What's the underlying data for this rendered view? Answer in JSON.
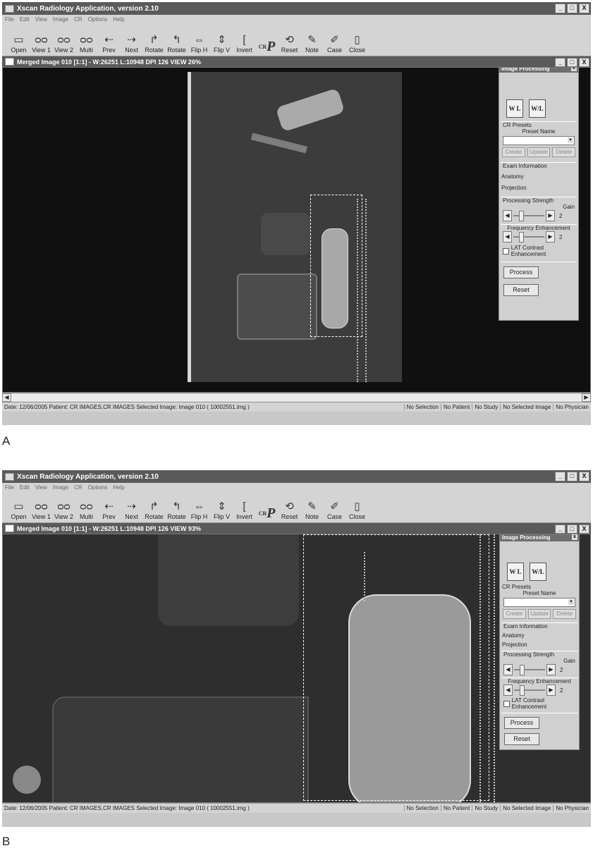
{
  "app": {
    "title": "Xscan Radiology Application, version 2.10",
    "window_controls": [
      "_",
      "□",
      "X"
    ]
  },
  "menu": [
    "File",
    "Edit",
    "View",
    "Image",
    "CR",
    "Options",
    "Help"
  ],
  "toolbar": {
    "open": "Open",
    "view1": "View 1",
    "view2": "View 2",
    "multi": "Multi",
    "prev": "Prev",
    "next": "Next",
    "rotate_cw": "Rotate",
    "rotate_ccw": "Rotate",
    "fliph": "Flip H",
    "flipv": "Flip V",
    "invert": "Invert",
    "cr_mark": "CR",
    "cr_letter": "P",
    "reset": "Reset",
    "note": "Note",
    "case": "Case",
    "close": "Close"
  },
  "panel": {
    "title": "Image Processing",
    "close": "x",
    "wl1": "W L",
    "wl2": "W/L",
    "cr_presets": "CR Presets",
    "preset_name": "Preset Name",
    "create": "Create",
    "update": "Update",
    "delete": "Delete",
    "exam_info": "Exam Information",
    "anatomy": "Anatomy",
    "projection": "Projection",
    "proc_strength": "Processing Strength",
    "gain": "Gain",
    "gain_value": "2",
    "freq_enh": "Frequency Enhancement",
    "freq_value": "2",
    "lat_contrast": "LAT Contrast Enhancement",
    "process": "Process",
    "reset": "Reset"
  },
  "status": {
    "left": "Date: 12/06/2005    Patient: CR IMAGES,CR IMAGES    Selected Image: Image 010  ( 10002551.img )",
    "cells": [
      "No Selection",
      "No Patient",
      "No Study",
      "No Selected Image",
      "No Physician"
    ]
  },
  "screens": {
    "a": {
      "figure_label": "A",
      "image_title": "Merged Image  010   [1:1]  - W:26251 L:10948  DPI 126  VIEW 26%"
    },
    "b": {
      "figure_label": "B",
      "image_title": "Merged Image  010   [1:1]  - W:26251 L:10948  DPI 126  VIEW 93%"
    }
  },
  "colors": {
    "titlebar": "#5a5a5a",
    "canvas": "#101010",
    "xray_plate": "#3a3a3a",
    "panel": "#d0d0d0"
  }
}
